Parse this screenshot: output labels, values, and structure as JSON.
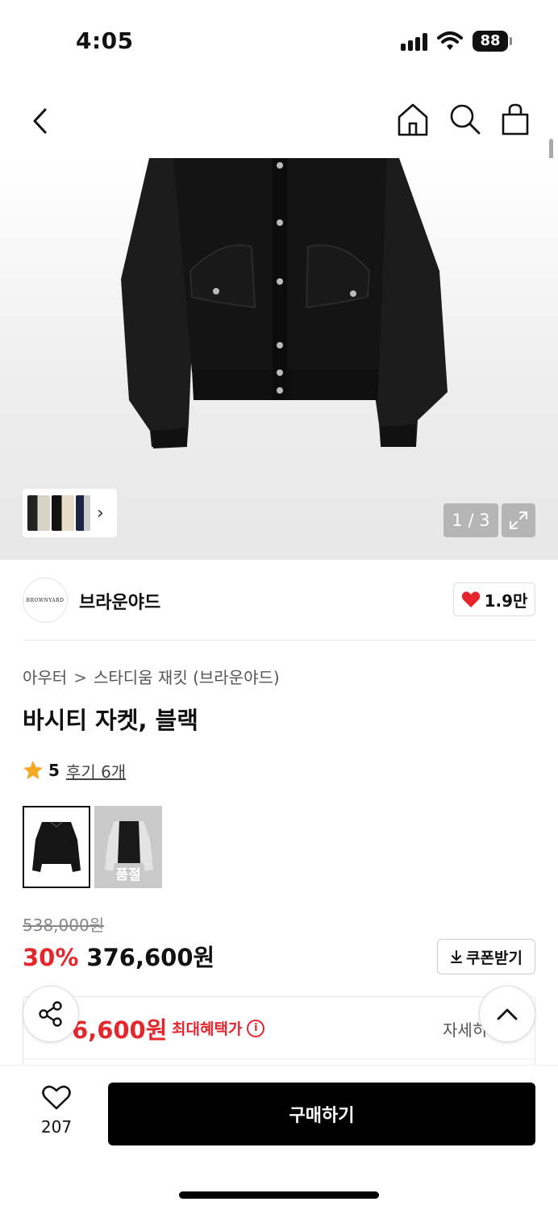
{
  "status_bar": {
    "time": "4:05",
    "battery": "88"
  },
  "gallery": {
    "counter": "1 / 3"
  },
  "brand": {
    "logo_text": "BROWNYARD",
    "name": "브라운야드",
    "likes": "1.9만"
  },
  "breadcrumb": {
    "category": "아우터",
    "separator": ">",
    "subcategory": "스타디움 재킷 (브라운야드)"
  },
  "product": {
    "title": "바시티 자켓, 블랙"
  },
  "rating": {
    "score": "5",
    "reviews": "후기 6개",
    "star_color": "#f5a623"
  },
  "color_options": [
    {
      "name": "black",
      "status": ""
    },
    {
      "name": "gray-sleeve",
      "status": "품절"
    }
  ],
  "price": {
    "original": "538,000원",
    "discount": "30%",
    "sale": "376,600원",
    "coupon_label": "쿠폰받기"
  },
  "benefit": {
    "price": "6,600원",
    "label": "최대혜택가",
    "info": "i",
    "detail": "자세히"
  },
  "bottom_bar": {
    "wish_count": "207",
    "buy_label": "구매하기"
  },
  "colors": {
    "accent_red": "#e6262d",
    "buy_button": "#000000",
    "heart_red": "#e8242c"
  }
}
